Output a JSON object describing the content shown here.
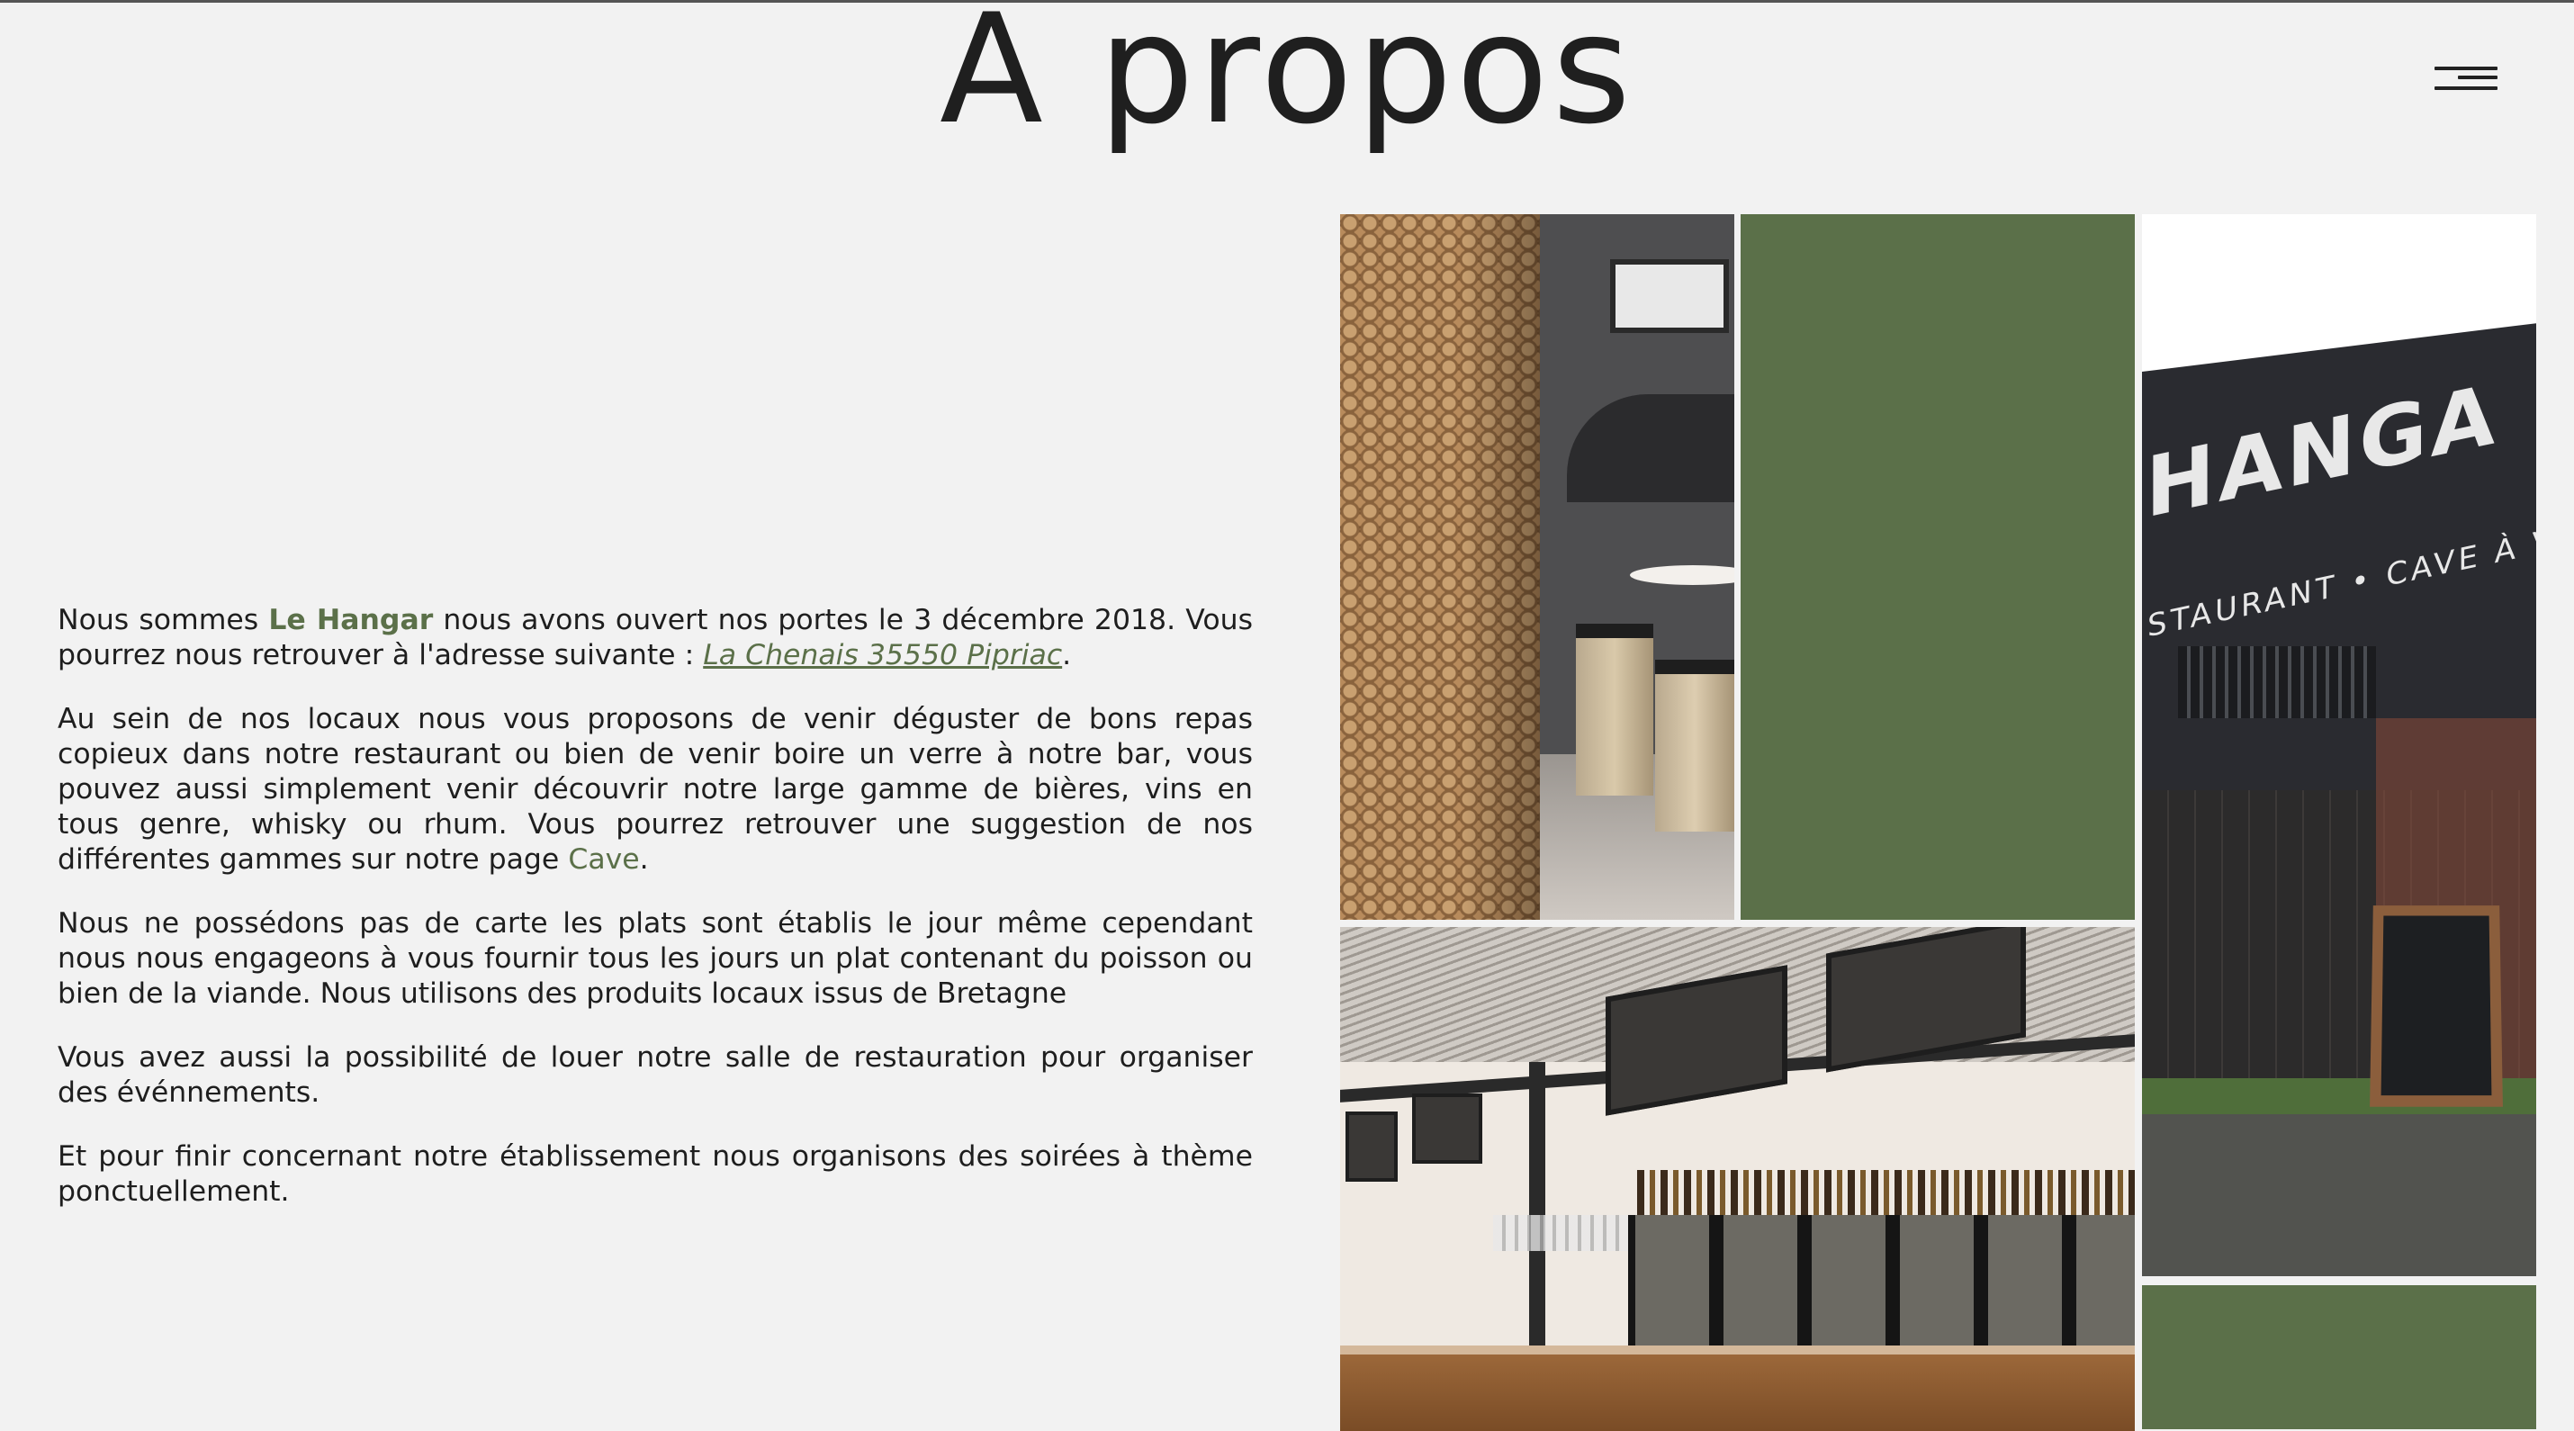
{
  "page": {
    "title": "A propos"
  },
  "nav": {
    "menu_icon": "hamburger-menu-icon"
  },
  "about": {
    "p1_a": "Nous sommes ",
    "p1_brand": "Le Hangar",
    "p1_b": " nous avons ouvert nos portes le 3 décembre 2018. Vous pourrez nous retrouver à l'adresse suivante : ",
    "p1_address": "La Chenais 35550 Pipriac",
    "p1_end": ".",
    "p2_a": "Au sein de nos locaux nous vous proposons de venir déguster de bons repas copieux dans notre restaurant ou bien de venir boire un verre à notre bar, vous pouvez aussi simplement venir découvrir notre large gamme de bières, vins en tous genre, whisky ou rhum. Vous pourrez retrouver une suggestion de nos différentes gammes sur notre page ",
    "p2_link": "Cave",
    "p2_end": ".",
    "p3": "Nous ne possédons pas de carte les plats sont établis le jour même cependant nous nous engageons à vous fournir tous les jours un plat contenant du poisson ou bien de la viande. Nous utilisons des produits locaux issus de Bretagne",
    "p4": "Vous avez aussi la possibilité de louer notre salle de restauration pour organiser des événnements.",
    "p5": "Et pour finir concernant notre établissement nous organisons des soirées à thème ponctuellement."
  },
  "gallery": {
    "storefront_sign": "HANGA",
    "storefront_sub": "STAURANT • CAVE À V",
    "accent_color": "#5b7049"
  }
}
